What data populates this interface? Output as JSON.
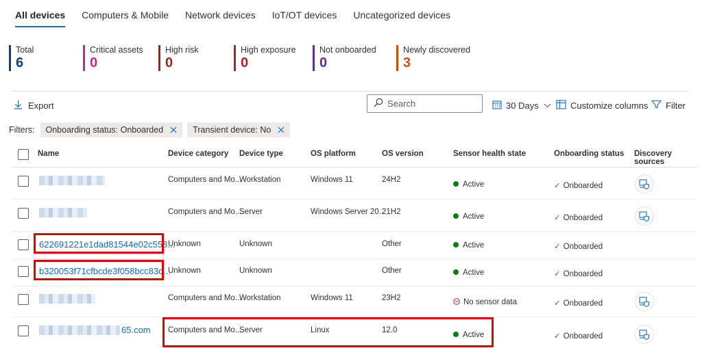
{
  "tabs": [
    {
      "label": "All devices",
      "active": true
    },
    {
      "label": "Computers & Mobile"
    },
    {
      "label": "Network devices"
    },
    {
      "label": "IoT/OT devices"
    },
    {
      "label": "Uncategorized devices"
    }
  ],
  "stats": [
    {
      "label": "Total",
      "value": "6",
      "color": "#0f3f74"
    },
    {
      "label": "Critical assets",
      "value": "0",
      "color": "#c2288f"
    },
    {
      "label": "High risk",
      "value": "0",
      "color": "#8e2b1f"
    },
    {
      "label": "High exposure",
      "value": "0",
      "color": "#a4262c"
    },
    {
      "label": "Not onboarded",
      "value": "0",
      "color": "#5c2e91"
    },
    {
      "label": "Newly discovered",
      "value": "3",
      "color": "#ca5010"
    }
  ],
  "toolbar": {
    "export_label": "Export",
    "search_placeholder": "Search",
    "days_label": "30 Days",
    "customize_label": "Customize columns",
    "filter_label": "Filter"
  },
  "filters": {
    "label": "Filters:",
    "chips": [
      "Onboarding status: Onboarded",
      "Transient device: No"
    ]
  },
  "table": {
    "columns": [
      "Name",
      "Device category",
      "Device type",
      "OS platform",
      "OS version",
      "Sensor health state",
      "Onboarding status",
      "Discovery sources"
    ],
    "rows": [
      {
        "name": "",
        "category": "Computers and Mo...",
        "type": "Workstation",
        "os": "Windows 11",
        "version": "24H2",
        "health": "Active",
        "onboarding": "Onboarded"
      },
      {
        "name": "",
        "category": "Computers and Mo...",
        "type": "Server",
        "os": "Windows Server 20...",
        "version": "21H2",
        "health": "Active",
        "onboarding": "Onboarded"
      },
      {
        "name": "622691221e1dad81544e02c558...",
        "category": "Unknown",
        "type": "Unknown",
        "os": "",
        "version": "Other",
        "health": "Active",
        "onboarding": "Onboarded"
      },
      {
        "name": "b320053f71cfbcde3f058bcc83d...",
        "category": "Unknown",
        "type": "Unknown",
        "os": "",
        "version": "Other",
        "health": "Active",
        "onboarding": "Onboarded"
      },
      {
        "name": "",
        "category": "Computers and Mo...",
        "type": "Workstation",
        "os": "Windows 11",
        "version": "23H2",
        "health": "No sensor data",
        "onboarding": "Onboarded"
      },
      {
        "name": "65.com",
        "category": "Computers and Mo...",
        "type": "Server",
        "os": "Linux",
        "version": "12.0",
        "health": "Active",
        "onboarding": "Onboarded"
      }
    ]
  },
  "colors": {
    "accent": "#0f6cbd",
    "active": "#107c10",
    "highlight": "#e00000"
  }
}
